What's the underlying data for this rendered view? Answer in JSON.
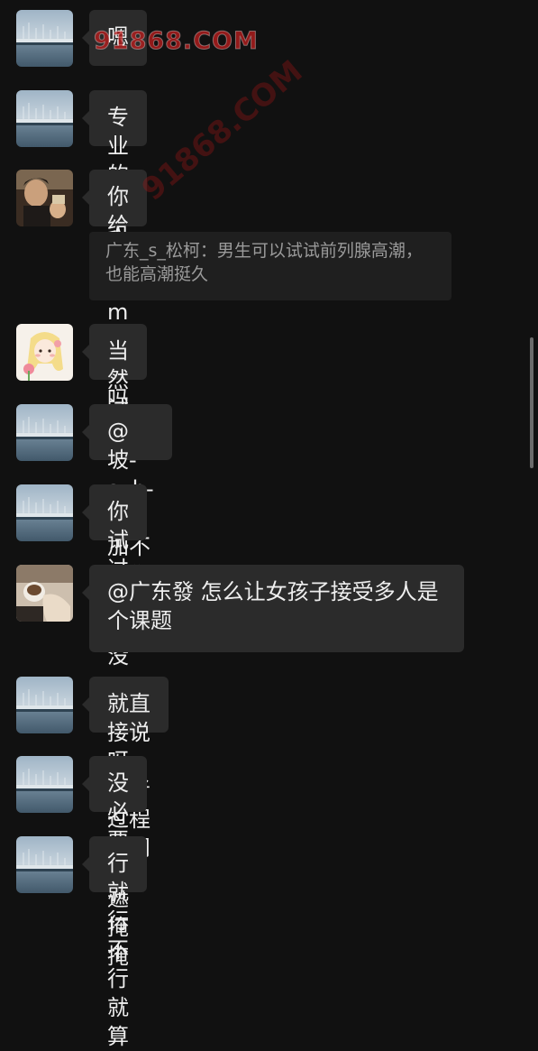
{
  "messages": [
    {
      "avatar": "harbor-avatar",
      "text": "嗯"
    },
    {
      "avatar": "harbor-avatar",
      "text": "专业的多人玩家"
    },
    {
      "avatar": "man-photo-avatar",
      "text": "你给你的m试过吗",
      "quote": "广东_s_松柯：男生可以试试前列腺高潮，也能高潮挺久"
    },
    {
      "avatar": "cartoon-girl-avatar",
      "text": "当然试过"
    },
    {
      "avatar": "harbor-avatar",
      "text": "@坡-sub-猫 加不了你"
    },
    {
      "avatar": "harbor-avatar",
      "text": "你试过多人没"
    },
    {
      "avatar": "hand-cup-avatar",
      "text": "@广东發 怎么让女孩子接受多人是个课题"
    },
    {
      "avatar": "harbor-avatar",
      "text": "就直接说呀，或者过程中问"
    },
    {
      "avatar": "harbor-avatar",
      "text": "没必要遮遮掩掩"
    },
    {
      "avatar": "harbor-avatar",
      "text": "行就行不行就算"
    }
  ],
  "watermark": "91868.COM",
  "watermark_diag": "91868.COM",
  "colors": {
    "background": "#111111",
    "bubble": "#2b2b2b",
    "quote_bg": "#1f1f1f",
    "text": "#eeeeee",
    "quote_text": "#9a9a9a",
    "watermark": "#be1e1e"
  }
}
